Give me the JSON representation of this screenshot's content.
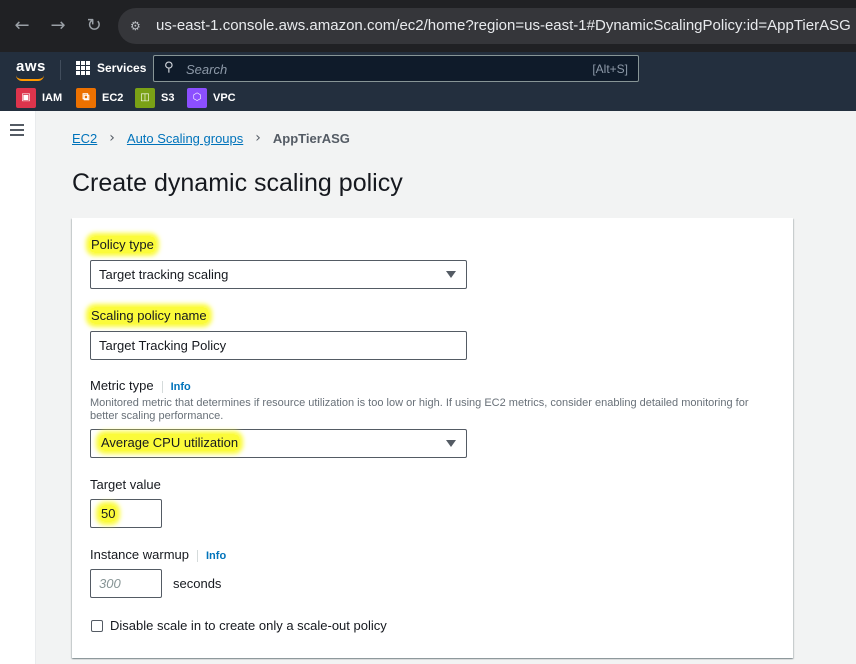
{
  "browser": {
    "back_glyph": "←",
    "forward_glyph": "→",
    "reload_glyph": "↻",
    "site_info_glyph": "⚙",
    "url": "us-east-1.console.aws.amazon.com/ec2/home?region=us-east-1#DynamicScalingPolicy:id=AppTierASG"
  },
  "aws_nav": {
    "logo": "aws",
    "services_label": "Services",
    "search_placeholder": "Search",
    "search_shortcut": "[Alt+S]",
    "favorites": [
      {
        "label": "IAM",
        "color": "#dd344c",
        "icon": "iam-icon",
        "glyph": "▣"
      },
      {
        "label": "EC2",
        "color": "#ed7100",
        "icon": "ec2-icon",
        "glyph": "⧉"
      },
      {
        "label": "S3",
        "color": "#7aa116",
        "icon": "s3-icon",
        "glyph": "◫"
      },
      {
        "label": "VPC",
        "color": "#8c4fff",
        "icon": "vpc-icon",
        "glyph": "⬡"
      }
    ]
  },
  "breadcrumb": {
    "items": [
      "EC2",
      "Auto Scaling groups"
    ],
    "current": "AppTierASG",
    "separator": "›"
  },
  "page": {
    "title": "Create dynamic scaling policy"
  },
  "form": {
    "policy_type": {
      "label": "Policy type",
      "value": "Target tracking scaling"
    },
    "policy_name": {
      "label": "Scaling policy name",
      "value": "Target Tracking Policy"
    },
    "metric_type": {
      "label": "Metric type",
      "info": "Info",
      "description": "Monitored metric that determines if resource utilization is too low or high. If using EC2 metrics, consider enabling detailed monitoring for better scaling performance.",
      "value": "Average CPU utilization"
    },
    "target_value": {
      "label": "Target value",
      "value": "50"
    },
    "instance_warmup": {
      "label": "Instance warmup",
      "info": "Info",
      "placeholder": "300",
      "suffix": "seconds"
    },
    "disable_scale_in": {
      "label": "Disable scale in to create only a scale-out policy",
      "checked": false
    }
  },
  "colors": {
    "highlight": "#fbfb3a",
    "link": "#0073bb",
    "aws_nav_bg": "#232f3e"
  }
}
